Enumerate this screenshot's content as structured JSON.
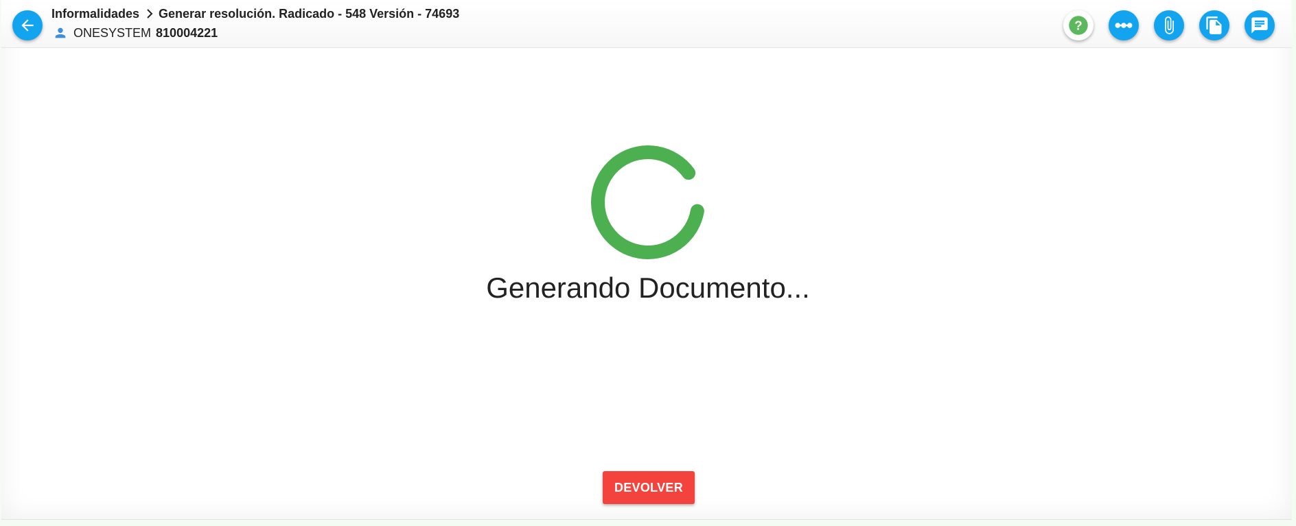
{
  "header": {
    "breadcrumb": {
      "parent": "Informalidades",
      "current": "Generar resolución. Radicado - 548 Versión - 74693"
    },
    "user": {
      "name": "ONESYSTEM",
      "id": "810004221"
    },
    "icons": {
      "back": "arrow-left-icon",
      "separator": "chevron-right-icon",
      "user": "person-icon"
    }
  },
  "toolbar": [
    {
      "icon": "help-icon",
      "style": "white"
    },
    {
      "icon": "flow-icon",
      "style": "blue"
    },
    {
      "icon": "attachment-icon",
      "style": "blue"
    },
    {
      "icon": "documents-icon",
      "style": "blue"
    },
    {
      "icon": "comments-icon",
      "style": "blue"
    }
  ],
  "main": {
    "loading_text": "Generando Documento..."
  },
  "footer": {
    "return_label": "DEVOLVER"
  },
  "colors": {
    "primary": "#12a4ee",
    "spinner": "#4caf50",
    "danger": "#f4433c",
    "help": "#5cb85c"
  }
}
